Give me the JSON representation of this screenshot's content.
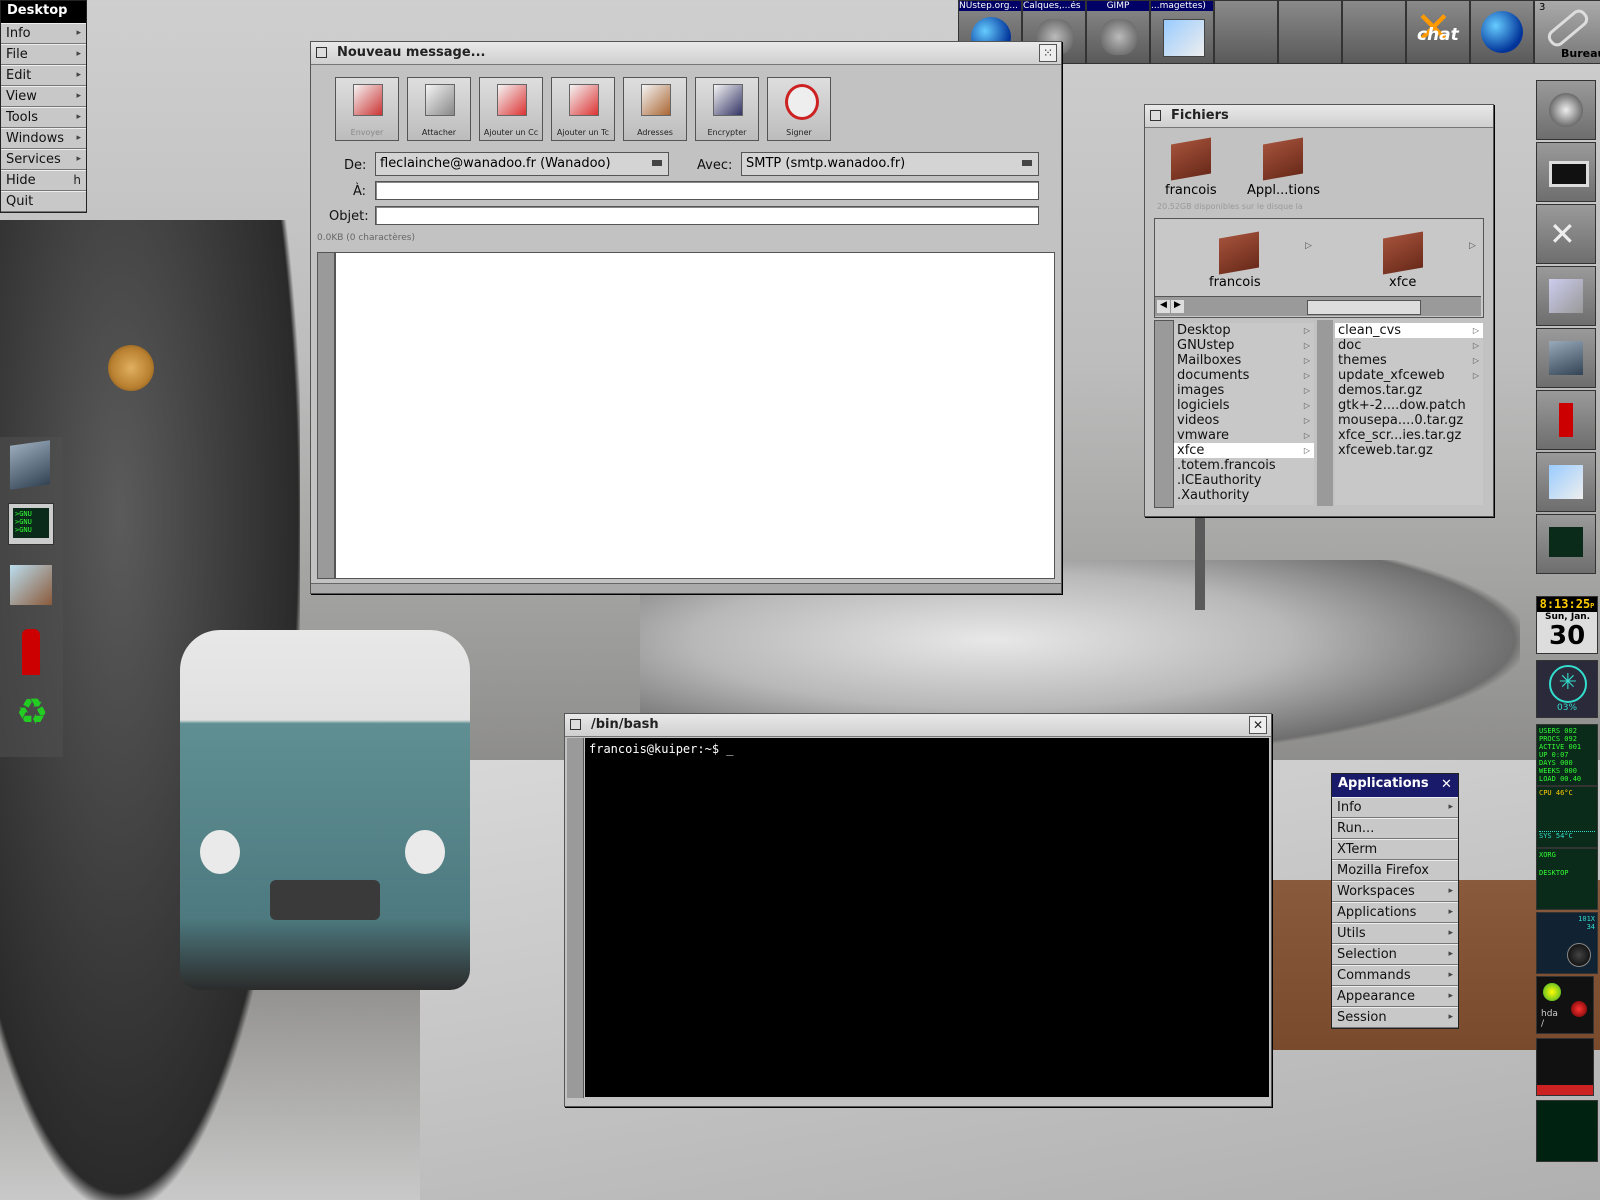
{
  "desktop_menu": {
    "title": "Desktop",
    "items": [
      {
        "label": "Info",
        "arrow": "▸"
      },
      {
        "label": "File",
        "arrow": "▸"
      },
      {
        "label": "Edit",
        "arrow": "▸"
      },
      {
        "label": "View",
        "arrow": "▸"
      },
      {
        "label": "Tools",
        "arrow": "▸"
      },
      {
        "label": "Windows",
        "arrow": "▸"
      },
      {
        "label": "Services",
        "arrow": "▸"
      },
      {
        "label": "Hide",
        "key": "h"
      },
      {
        "label": "Quit"
      }
    ]
  },
  "taskbar": {
    "items": [
      "NUstep.org...",
      "Calques,...és",
      "GIMP",
      "...magettes)"
    ],
    "workspace_number": "3",
    "workspace_label": "Bureau"
  },
  "chat_icon_label": "chat",
  "compose": {
    "title": "Nouveau message...",
    "toolbar": [
      {
        "label": "Envoyer",
        "icon": "stamp-icon"
      },
      {
        "label": "Attacher",
        "icon": "paperclip-icon"
      },
      {
        "label": "Ajouter un Cc",
        "icon": "add-cc-icon"
      },
      {
        "label": "Ajouter un Tc",
        "icon": "add-bcc-icon"
      },
      {
        "label": "Adresses",
        "icon": "address-book-icon"
      },
      {
        "label": "Encrypter",
        "icon": "lock-icon"
      },
      {
        "label": "Signer",
        "icon": "sign-icon"
      }
    ],
    "from_label": "De:",
    "from_value": "fleclainche@wanadoo.fr (Wanadoo)",
    "via_label": "Avec:",
    "via_value": "SMTP (smtp.wanadoo.fr)",
    "to_label": "À:",
    "to_value": "",
    "subject_label": "Objet:",
    "subject_value": "",
    "size_info": "0.0KB (0 charactères)"
  },
  "files": {
    "title": "Fichiers",
    "shelf": [
      "francois",
      "Appl...tions"
    ],
    "disk_info": "20.52GB disponibles sur le disque la",
    "path": [
      "francois",
      "xfce"
    ],
    "col1": [
      "Desktop",
      "GNUstep",
      "Mailboxes",
      "documents",
      "images",
      "logiciels",
      "videos",
      "vmware",
      "xfce",
      ".totem.francois",
      ".ICEauthority",
      ".Xauthority"
    ],
    "col1_arrows": [
      true,
      true,
      true,
      true,
      true,
      true,
      true,
      true,
      true,
      false,
      false,
      false
    ],
    "col1_selected": "xfce",
    "col2": [
      "clean_cvs",
      "doc",
      "themes",
      "update_xfceweb",
      "demos.tar.gz",
      "gtk+-2....dow.patch",
      "mousepa....0.tar.gz",
      "xfce_scr...ies.tar.gz",
      "xfceweb.tar.gz"
    ],
    "col2_arrows": [
      true,
      true,
      true,
      true,
      false,
      false,
      false,
      false,
      false
    ],
    "col2_selected": "clean_cvs"
  },
  "terminal": {
    "title": "/bin/bash",
    "prompt": "francois@kuiper:~$ _"
  },
  "apps_menu": {
    "title": "Applications",
    "items": [
      {
        "label": "Info",
        "arrow": "▸"
      },
      {
        "label": "Run..."
      },
      {
        "label": "XTerm"
      },
      {
        "label": "Mozilla Firefox"
      },
      {
        "label": "Workspaces",
        "arrow": "▸"
      },
      {
        "label": "Applications",
        "arrow": "▸"
      },
      {
        "label": "Utils",
        "arrow": "▸"
      },
      {
        "label": "Selection",
        "arrow": "▸"
      },
      {
        "label": "Commands",
        "arrow": "▸"
      },
      {
        "label": "Appearance",
        "arrow": "▸"
      },
      {
        "label": "Session",
        "arrow": "▸"
      }
    ]
  },
  "clock": {
    "time": "8:13:25",
    "ampm": "P",
    "date_label": "Sun, Jan.",
    "day": "30"
  },
  "cpu_monitor": {
    "percent": "03%"
  },
  "sysinfo": [
    "USERS  002",
    "PROCS  092",
    "ACTIVE 001",
    "UP    0:07",
    "DAYS   000",
    "WEEKS  000",
    "LOAD  00.40"
  ],
  "temp": {
    "cpu": "CPU  46°C",
    "sys": "SYS  54°C"
  },
  "net": {
    "a": "XORG",
    "b": "DESKTOP"
  },
  "mixer": {
    "value": "101X",
    "vol": "34"
  },
  "hda_label": "hda\n/",
  "gnu_lines": [
    ">GNU",
    ">GNU",
    ">GNU"
  ]
}
